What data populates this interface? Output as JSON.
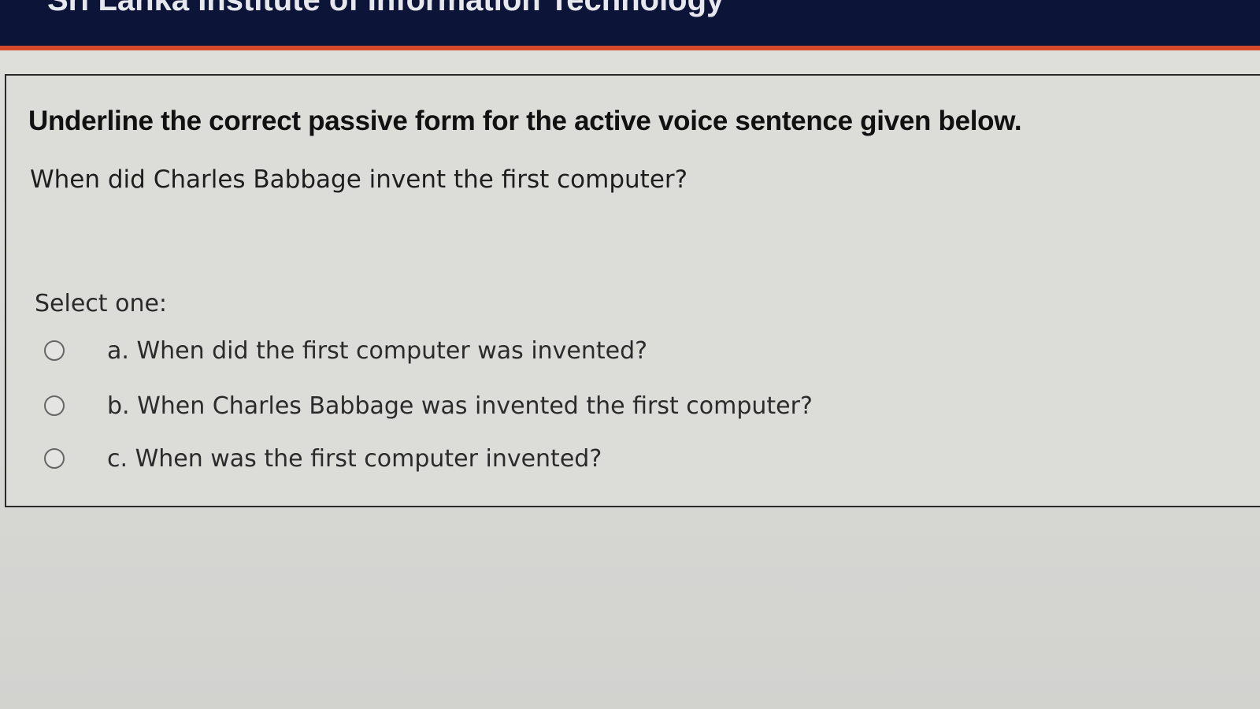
{
  "header": {
    "title": "Sri Lanka Institute of Information Technology"
  },
  "question": {
    "instruction": "Underline the correct passive form for the active voice sentence given below.",
    "sentence": "When did Charles Babbage invent the first computer?",
    "select_label": "Select one:",
    "options": [
      {
        "text": "a. When did the first computer was invented?",
        "selected": false
      },
      {
        "text": "b. When Charles Babbage was invented the first computer?",
        "selected": false
      },
      {
        "text": "c. When was the first computer invented?",
        "selected": false
      }
    ]
  },
  "colors": {
    "header_bg": "#0c1438",
    "accent": "#d44a2a",
    "page_bg": "#dcdcd9"
  }
}
